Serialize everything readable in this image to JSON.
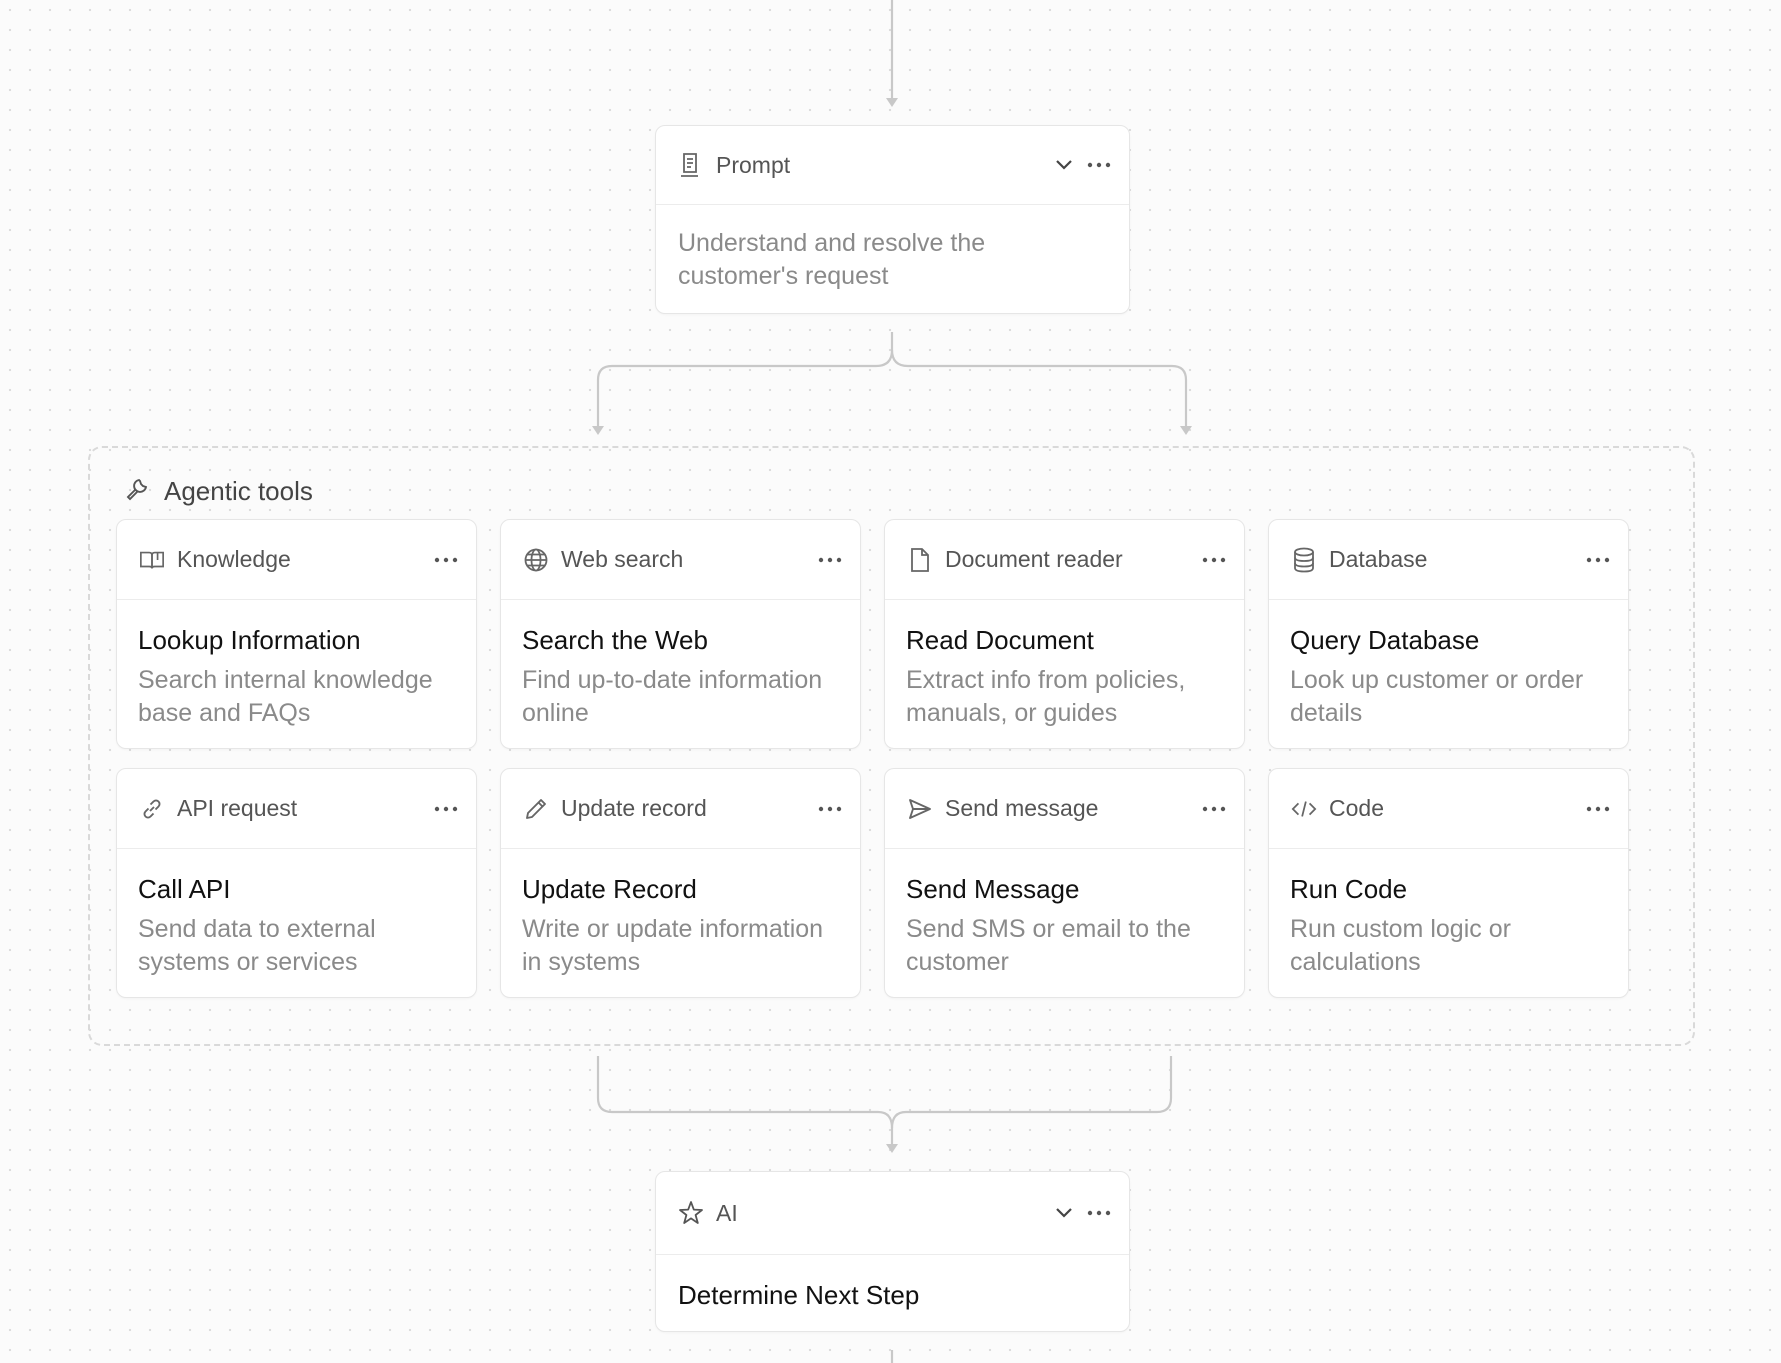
{
  "prompt_node": {
    "icon": "prompt-icon",
    "label": "Prompt",
    "body": "Understand and resolve the customer's request"
  },
  "group": {
    "icon": "wrench-icon",
    "title": "Agentic tools"
  },
  "tools": [
    {
      "icon": "book-icon",
      "type": "Knowledge",
      "title": "Lookup Information",
      "description": "Search internal knowledge base and FAQs"
    },
    {
      "icon": "globe-icon",
      "type": "Web search",
      "title": "Search the Web",
      "description": "Find up-to-date information online"
    },
    {
      "icon": "document-icon",
      "type": "Document reader",
      "title": "Read Document",
      "description": "Extract info from policies, manuals, or guides"
    },
    {
      "icon": "database-icon",
      "type": "Database",
      "title": "Query Database",
      "description": "Look up customer or order details"
    },
    {
      "icon": "link-icon",
      "type": "API request",
      "title": "Call API",
      "description": "Send data to external systems or services"
    },
    {
      "icon": "pencil-icon",
      "type": "Update record",
      "title": "Update Record",
      "description": "Write or update information in systems"
    },
    {
      "icon": "send-icon",
      "type": "Send message",
      "title": "Send Message",
      "description": "Send SMS or email to the customer"
    },
    {
      "icon": "code-icon",
      "type": "Code",
      "title": "Run Code",
      "description": "Run custom logic or calculations"
    }
  ],
  "ai_node": {
    "icon": "sparkle-icon",
    "label": "AI",
    "title": "Determine Next Step"
  }
}
